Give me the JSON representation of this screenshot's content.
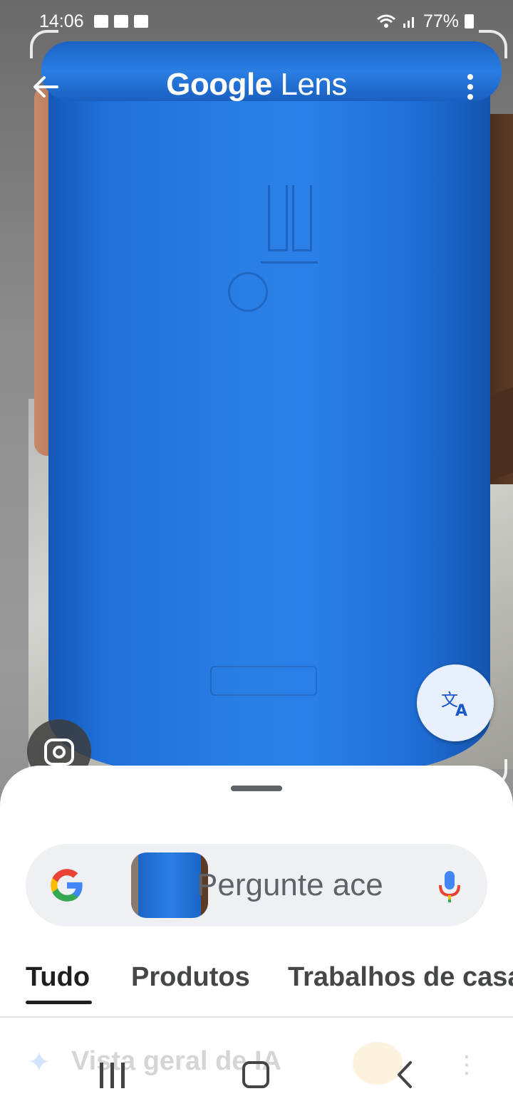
{
  "status_bar": {
    "time": "14:06",
    "battery": "77%",
    "icons": [
      "facebook-icon",
      "folder-icon",
      "calendar-icon",
      "wifi-icon",
      "signal-icon",
      "battery-icon"
    ]
  },
  "header": {
    "title_brand": "Google",
    "title_product": "Lens"
  },
  "search": {
    "placeholder": "Pergunte ace"
  },
  "tabs": [
    {
      "label": "Tudo",
      "active": true
    },
    {
      "label": "Produtos",
      "active": false
    },
    {
      "label": "Trabalhos de casa",
      "active": false
    }
  ],
  "ai_overview": {
    "label": "Vista geral de IA"
  },
  "colors": {
    "accent": "#1a73e8",
    "sheet_bg": "#ffffff",
    "searchbar_bg": "#eef0f4",
    "translate_bg": "#e8f0fe"
  }
}
